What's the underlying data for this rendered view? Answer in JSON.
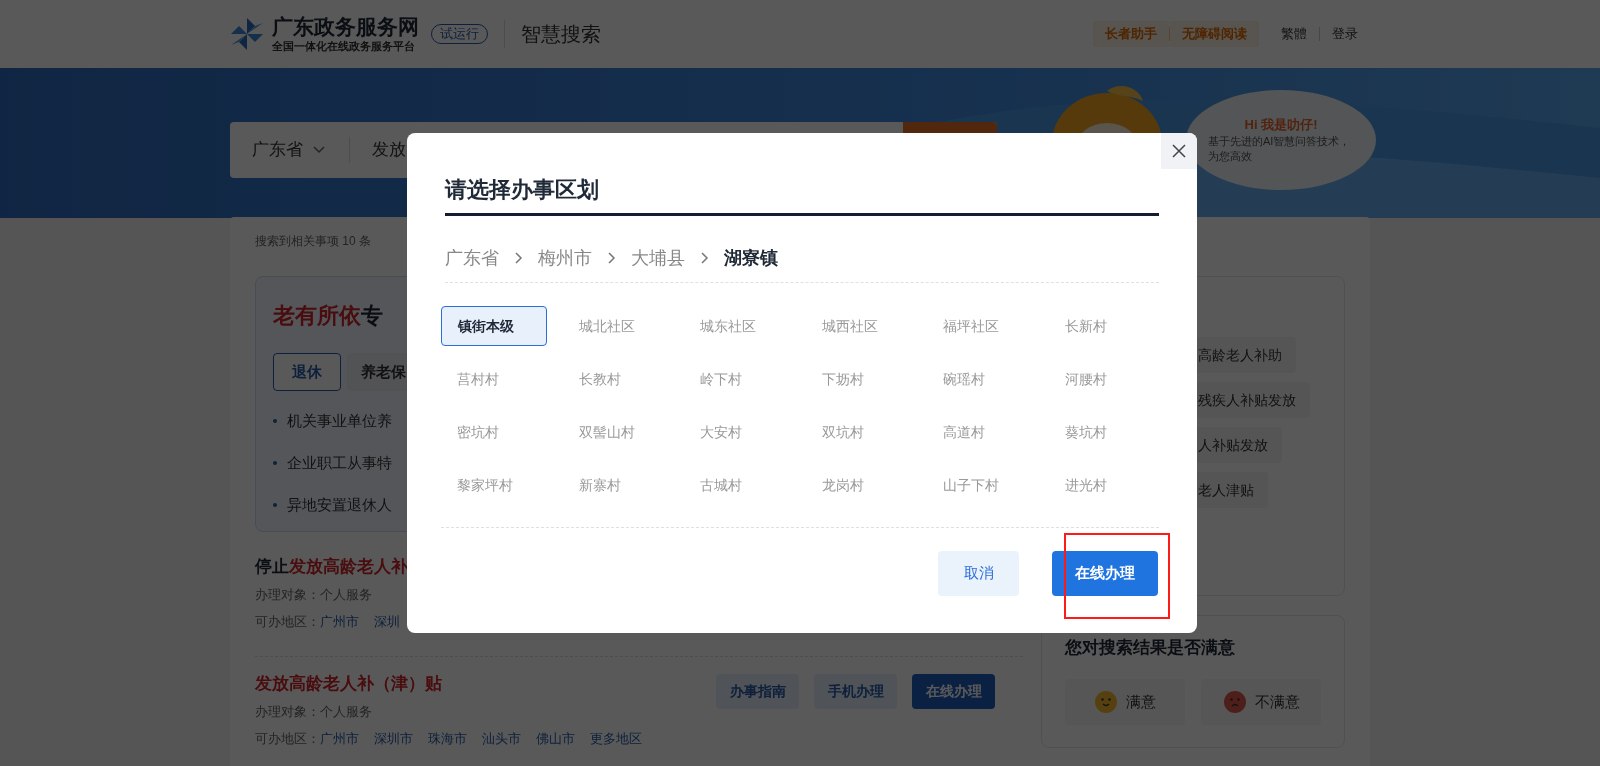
{
  "header": {
    "site_name": "广东政务服务网",
    "site_subtitle": "全国一体化在线政务服务平台",
    "badge": "试运行",
    "section": "智慧搜索",
    "tools": [
      {
        "label": "长者助手",
        "kind": "accent"
      },
      {
        "label": "无障碍阅读",
        "kind": "accent"
      },
      {
        "label": "繁體",
        "kind": "plain"
      },
      {
        "label": "登录",
        "kind": "plain"
      }
    ]
  },
  "search": {
    "region": "广东省",
    "query": "发放"
  },
  "assistant": {
    "greeting": "Hi 我是叻仔!",
    "lines": [
      "基于先进的AI智慧问答技术，",
      "为您高效"
    ]
  },
  "results_count": "搜索到相关事项 10 条",
  "column": {
    "title_highlight": "老有所依",
    "title_rest": "专",
    "tabs": [
      {
        "label": "退休",
        "selected": true
      },
      {
        "label": "养老保",
        "selected": false
      }
    ],
    "items": [
      "机关事业单位养",
      "企业职工从事特",
      "异地安置退休人"
    ]
  },
  "results": [
    {
      "title": [
        {
          "text": "停止",
          "highlight": false
        },
        {
          "text": "发放高龄老人补",
          "highlight": true
        }
      ],
      "target": "办理对象：个人服务",
      "regions_label": "可办地区：",
      "regions": [
        "广州市",
        "深圳"
      ]
    },
    {
      "title": [
        {
          "text": "发放高龄老人补（津）贴",
          "highlight": true
        }
      ],
      "target": "办理对象：个人服务",
      "regions_label": "可办地区：",
      "regions": [
        "广州市",
        "深圳市",
        "珠海市",
        "汕头市",
        "佛山市",
        "更多地区"
      ],
      "actions": [
        {
          "label": "办事指南",
          "primary": false
        },
        {
          "label": "手机办理",
          "primary": false
        },
        {
          "label": "在线办理",
          "primary": true
        }
      ]
    }
  ],
  "related": {
    "tags": [
      "高龄老人补助",
      "残疾人补贴发放",
      "人补贴发放",
      "老人津贴"
    ]
  },
  "feedback": {
    "title": "您对搜索结果是否满意",
    "options": [
      {
        "label": "满意",
        "kind": "happy"
      },
      {
        "label": "不满意",
        "kind": "sad"
      }
    ]
  },
  "dialog": {
    "title": "请选择办事区划",
    "breadcrumb": [
      {
        "label": "广东省",
        "current": false
      },
      {
        "label": "梅州市",
        "current": false
      },
      {
        "label": "大埔县",
        "current": false
      },
      {
        "label": "湖寮镇",
        "current": true
      }
    ],
    "options": [
      {
        "label": "镇街本级",
        "selected": true
      },
      {
        "label": "城北社区",
        "selected": false
      },
      {
        "label": "城东社区",
        "selected": false
      },
      {
        "label": "城西社区",
        "selected": false
      },
      {
        "label": "福坪社区",
        "selected": false
      },
      {
        "label": "长新村",
        "selected": false
      },
      {
        "label": "莒村村",
        "selected": false
      },
      {
        "label": "长教村",
        "selected": false
      },
      {
        "label": "岭下村",
        "selected": false
      },
      {
        "label": "下坜村",
        "selected": false
      },
      {
        "label": "碗瑶村",
        "selected": false
      },
      {
        "label": "河腰村",
        "selected": false
      },
      {
        "label": "密坑村",
        "selected": false
      },
      {
        "label": "双髻山村",
        "selected": false
      },
      {
        "label": "大安村",
        "selected": false
      },
      {
        "label": "双坑村",
        "selected": false
      },
      {
        "label": "高道村",
        "selected": false
      },
      {
        "label": "葵坑村",
        "selected": false
      },
      {
        "label": "黎家坪村",
        "selected": false
      },
      {
        "label": "新寨村",
        "selected": false
      },
      {
        "label": "古城村",
        "selected": false
      },
      {
        "label": "龙岗村",
        "selected": false
      },
      {
        "label": "山子下村",
        "selected": false
      },
      {
        "label": "进光村",
        "selected": false
      }
    ],
    "buttons": [
      {
        "label": "取消",
        "kind": "secondary"
      },
      {
        "label": "在线办理",
        "kind": "primary"
      }
    ],
    "highlight": true
  }
}
